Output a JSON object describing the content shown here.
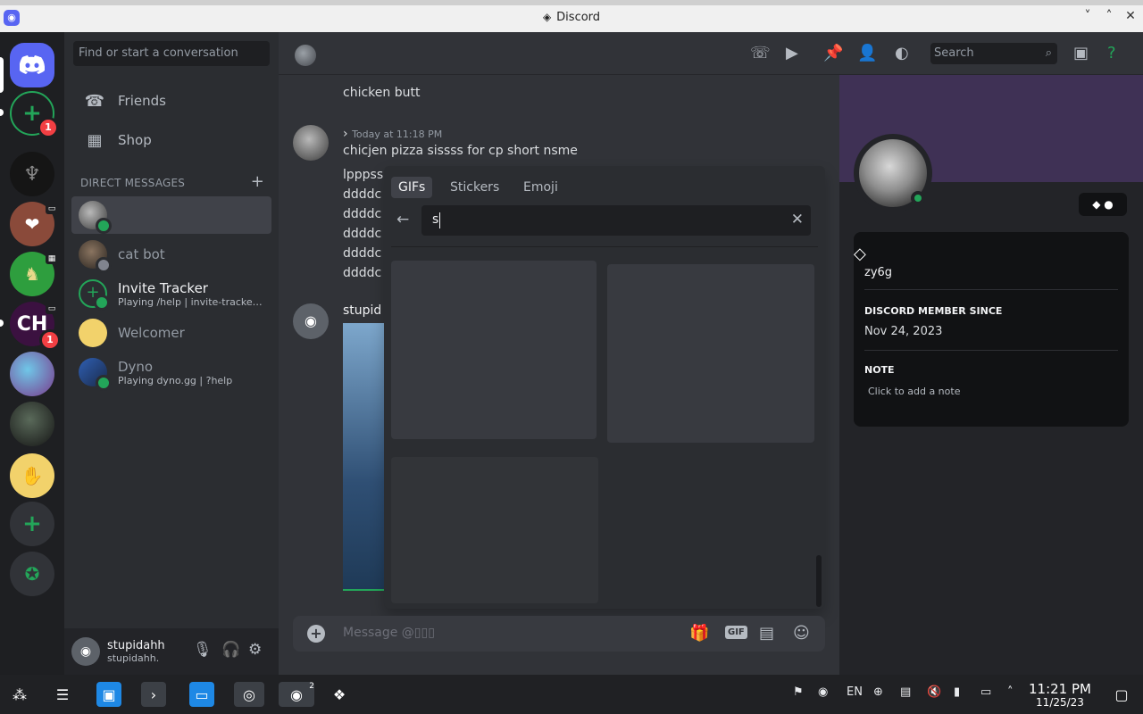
{
  "window": {
    "title": "Discord",
    "controls": [
      "˅",
      "˄",
      "✕"
    ]
  },
  "channels": {
    "search_placeholder": "Find or start a conversation",
    "nav": [
      {
        "label": "Friends"
      },
      {
        "label": "Shop"
      }
    ],
    "dm_header": "DIRECT MESSAGES",
    "dms": [
      {
        "name": "",
        "sub": ""
      },
      {
        "name": "cat bot",
        "sub": ""
      },
      {
        "name": "Invite Tracker",
        "sub": "Playing /help | invite-tracker...."
      },
      {
        "name": "Welcomer",
        "sub": ""
      },
      {
        "name": "Dyno",
        "sub": "Playing dyno.gg | ?help"
      }
    ],
    "user": {
      "display": "stupidahh",
      "handle": "stupidahh."
    }
  },
  "guild_badges": {
    "add_server_badge": "1",
    "ch_badge": "1",
    "ch_label": "CH"
  },
  "header": {
    "search_placeholder": "Search"
  },
  "messages": {
    "m1_text": "chicken butt",
    "m2_timestamp": "Today at 11:18 PM",
    "m2_text": "chicjen pizza sissss for cp short nsme",
    "m2_lines": [
      "lpppss",
      "ddddc",
      "ddddc",
      "ddddc",
      "ddddc",
      "ddddc"
    ],
    "m3_author": "stupid"
  },
  "picker": {
    "tabs": [
      "GIFs",
      "Stickers",
      "Emoji"
    ],
    "active_tab": "GIFs",
    "search_value": "s"
  },
  "composer": {
    "placeholder": "Message @▯▯▯"
  },
  "profile": {
    "username": "zy6g",
    "member_since_label": "DISCORD MEMBER SINCE",
    "member_since": "Nov 24, 2023",
    "note_label": "NOTE",
    "note_placeholder": "Click to add a note"
  },
  "taskbar": {
    "discord_badge": "2",
    "lang": "EN",
    "time": "11:21 PM",
    "date": "11/25/23"
  },
  "colors": {
    "blurple": "#5865f2",
    "online": "#23a559",
    "danger": "#f23f43",
    "banner": "#3f3155"
  }
}
